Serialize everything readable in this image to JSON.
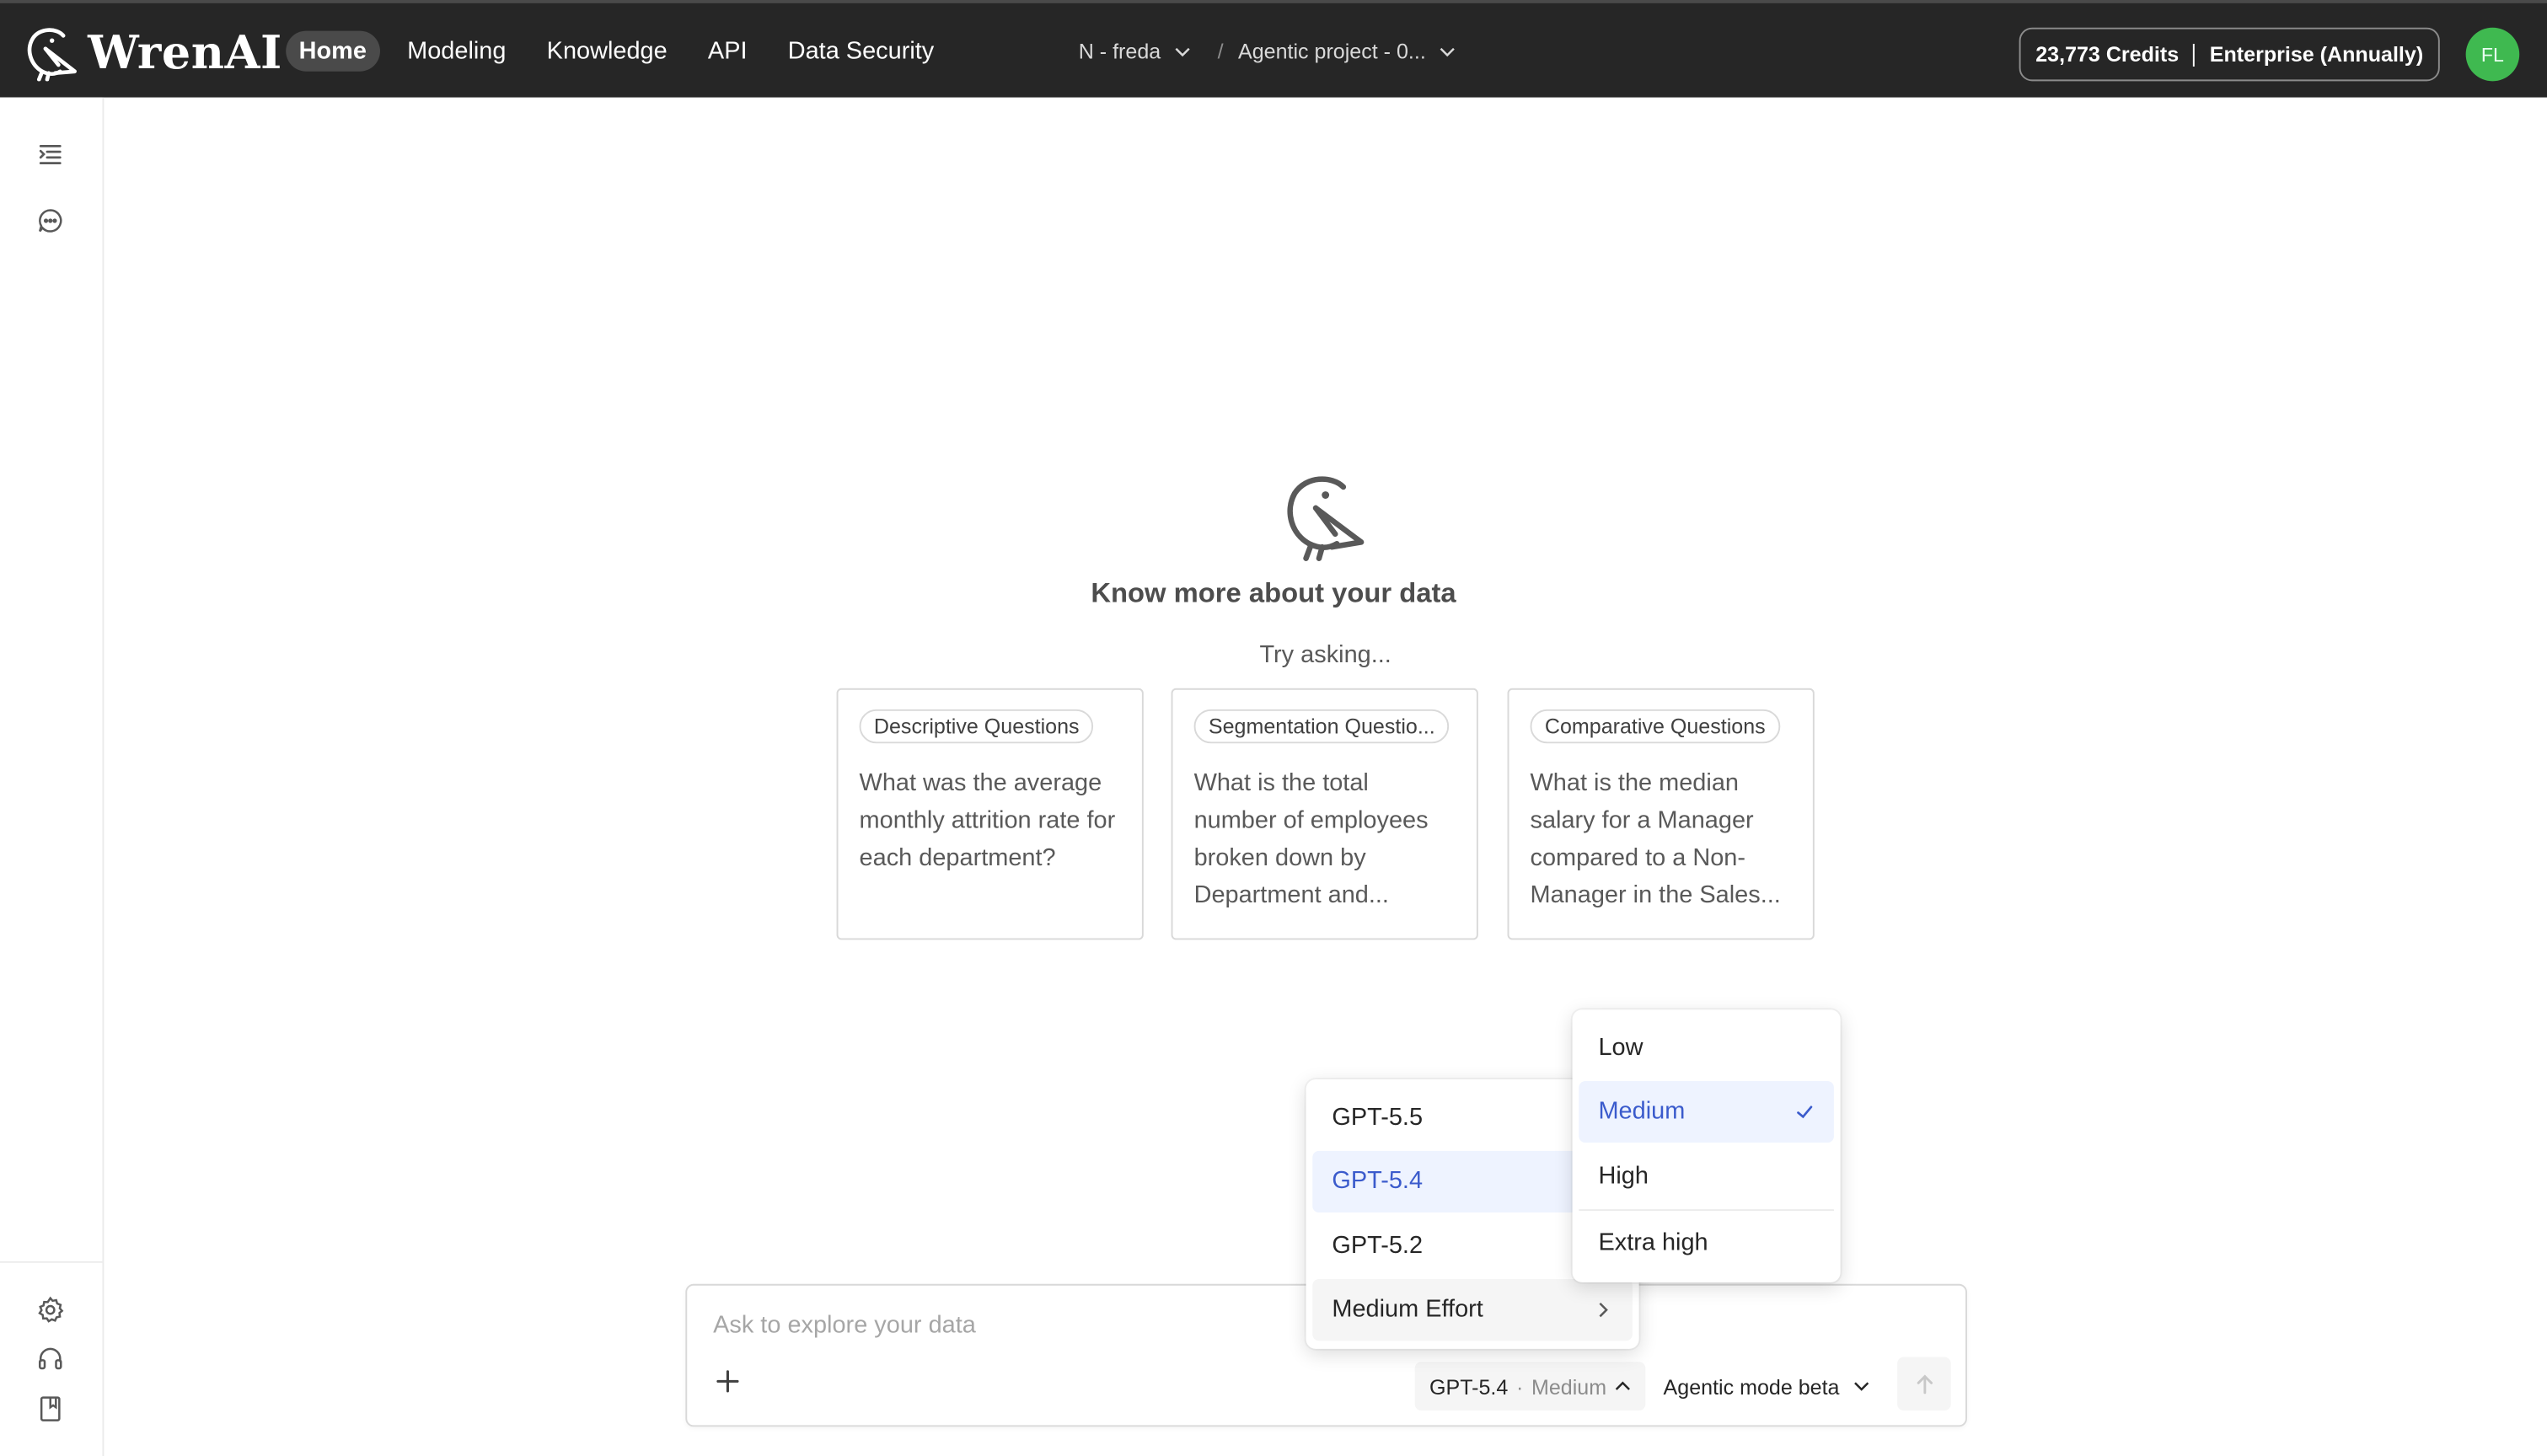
{
  "app": {
    "name": "WrenAI"
  },
  "nav": {
    "items": [
      {
        "label": "Home",
        "active": true
      },
      {
        "label": "Modeling",
        "active": false
      },
      {
        "label": "Knowledge",
        "active": false
      },
      {
        "label": "API",
        "active": false
      },
      {
        "label": "Data Security",
        "active": false
      }
    ]
  },
  "breadcrumb": {
    "workspace": "N - freda",
    "separator": "/",
    "project": "Agentic project - 0..."
  },
  "account": {
    "credits": "23,773 Credits",
    "plan": "Enterprise (Annually)",
    "avatar_initials": "FL",
    "avatar_color": "#3fb950"
  },
  "sidebar": {
    "icons": [
      "list-indent-icon",
      "chat-bubble-icon",
      "gear-icon",
      "headset-icon",
      "book-icon"
    ]
  },
  "main": {
    "title": "Know more about your data",
    "prompt": "Try asking...",
    "cards": [
      {
        "tag": "Descriptive Questions",
        "question": "What was the average monthly attrition rate for each department?"
      },
      {
        "tag": "Segmentation Questio...",
        "question": "What is the total number of employees broken down by Department and..."
      },
      {
        "tag": "Comparative Questions",
        "question": "What is the median salary for a Manager compared to a Non-Manager in the Sales..."
      }
    ]
  },
  "composer": {
    "placeholder": "Ask to explore your data",
    "model": "GPT-5.4",
    "effort": "Medium",
    "mode": "Agentic mode beta"
  },
  "model_menu": {
    "items": [
      {
        "label": "GPT-5.5",
        "selected": false
      },
      {
        "label": "GPT-5.4",
        "selected": true
      },
      {
        "label": "GPT-5.2",
        "selected": false
      }
    ],
    "effort_item": "Medium Effort"
  },
  "effort_menu": {
    "items": [
      {
        "label": "Low",
        "selected": false
      },
      {
        "label": "Medium",
        "selected": true
      },
      {
        "label": "High",
        "selected": false
      },
      {
        "label": "Extra high",
        "selected": false
      }
    ]
  },
  "colors": {
    "topbar": "#262626",
    "accent": "#3b5bcc",
    "selected_bg": "#eef3ff"
  }
}
